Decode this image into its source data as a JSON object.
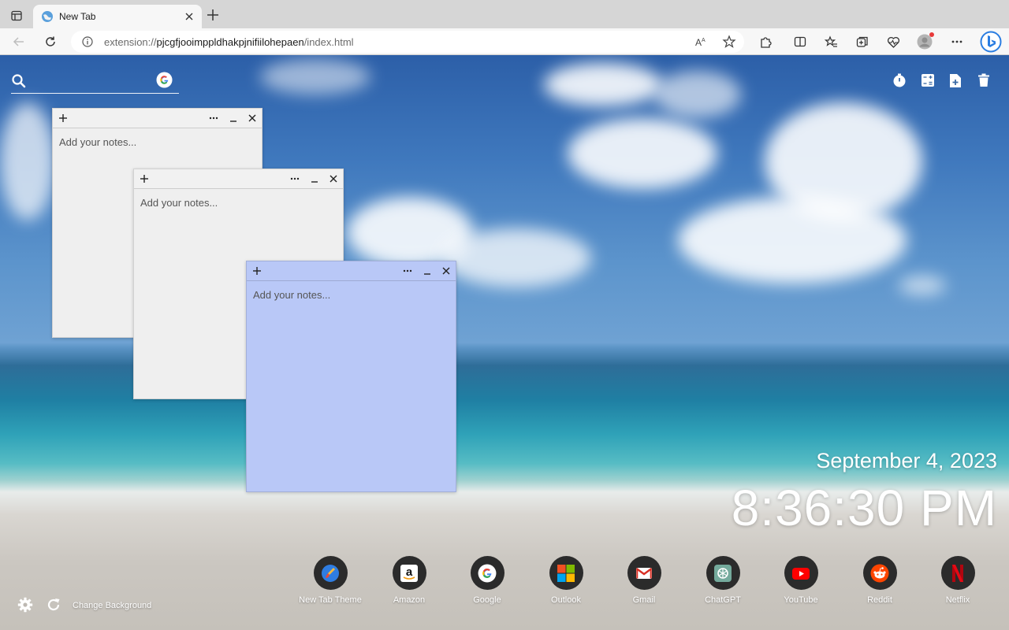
{
  "browser": {
    "tab": {
      "title": "New Tab"
    },
    "address": {
      "scheme": "extension://",
      "host": "pjcgfjooimppldhakpjnifiilohepaen",
      "path": "/index.html"
    }
  },
  "search": {
    "placeholder": "",
    "engine_icon": "google-icon"
  },
  "tools": [
    "timer-icon",
    "calculator-icon",
    "add-note-icon",
    "trash-icon"
  ],
  "notes": [
    {
      "placeholder": "Add your notes...",
      "color": "#efefef"
    },
    {
      "placeholder": "Add your notes...",
      "color": "#efefef"
    },
    {
      "placeholder": "Add your notes...",
      "color": "#b9c8f7"
    }
  ],
  "clock": {
    "date": "September 4, 2023",
    "time": "8:36:30 PM"
  },
  "shortcuts": [
    {
      "label": "New Tab Theme",
      "icon": "brush-icon"
    },
    {
      "label": "Amazon",
      "icon": "amazon-icon"
    },
    {
      "label": "Google",
      "icon": "google-icon"
    },
    {
      "label": "Outlook",
      "icon": "microsoft-icon"
    },
    {
      "label": "Gmail",
      "icon": "gmail-icon"
    },
    {
      "label": "ChatGPT",
      "icon": "chatgpt-icon"
    },
    {
      "label": "YouTube",
      "icon": "youtube-icon"
    },
    {
      "label": "Reddit",
      "icon": "reddit-icon"
    },
    {
      "label": "Netflix",
      "icon": "netflix-icon"
    }
  ],
  "footer": {
    "change_background": "Change Background"
  }
}
